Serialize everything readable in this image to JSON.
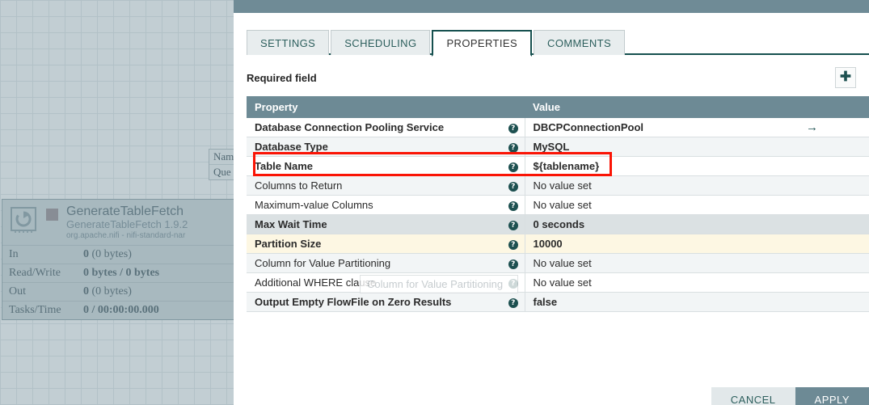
{
  "canvas": {
    "connection_label": {
      "name_row": "Nam",
      "queued_row": "Que"
    },
    "processor": {
      "icon": "processor-refresh-icon",
      "status_indicator": "stopped-square-icon",
      "name": "GenerateTableFetch",
      "type_version": "GenerateTableFetch 1.9.2",
      "bundle": "org.apache.nifi - nifi-standard-nar",
      "stats": [
        {
          "label": "In",
          "value": "0",
          "suffix": " (0 bytes)"
        },
        {
          "label": "Read/Write",
          "value": "0 bytes / 0 bytes",
          "suffix": ""
        },
        {
          "label": "Out",
          "value": "0",
          "suffix": " (0 bytes)"
        },
        {
          "label": "Tasks/Time",
          "value": "0 / 00:00:00.000",
          "suffix": ""
        }
      ]
    }
  },
  "dialog": {
    "tabs": [
      {
        "label": "SETTINGS",
        "active": false
      },
      {
        "label": "SCHEDULING",
        "active": false
      },
      {
        "label": "PROPERTIES",
        "active": true
      },
      {
        "label": "COMMENTS",
        "active": false
      }
    ],
    "required_field_label": "Required field",
    "add_property_icon": "plus-icon",
    "table": {
      "headers": {
        "property": "Property",
        "value": "Value",
        "extra": ""
      },
      "rows": [
        {
          "property": "Database Connection Pooling Service",
          "value": "DBCPConnectionPool",
          "required": true,
          "no_value": false,
          "extra": "→",
          "style": "row-odd"
        },
        {
          "property": "Database Type",
          "value": "MySQL",
          "required": true,
          "no_value": false,
          "extra": "",
          "style": "row-even"
        },
        {
          "property": "Table Name",
          "value": "${tablename}",
          "required": true,
          "no_value": false,
          "extra": "",
          "style": "row-odd"
        },
        {
          "property": "Columns to Return",
          "value": "No value set",
          "required": false,
          "no_value": true,
          "extra": "",
          "style": "row-even"
        },
        {
          "property": "Maximum-value Columns",
          "value": "No value set",
          "required": false,
          "no_value": true,
          "extra": "",
          "style": "row-odd"
        },
        {
          "property": "Max Wait Time",
          "value": "0 seconds",
          "required": true,
          "no_value": false,
          "extra": "",
          "style": "row-hl"
        },
        {
          "property": "Partition Size",
          "value": "10000",
          "required": true,
          "no_value": false,
          "extra": "",
          "style": "row-warn"
        },
        {
          "property": "Column for Value Partitioning",
          "value": "No value set",
          "required": false,
          "no_value": true,
          "extra": "",
          "style": "row-even"
        },
        {
          "property": "Additional WHERE clause",
          "value": "No value set",
          "required": false,
          "no_value": true,
          "extra": "",
          "style": "row-odd"
        },
        {
          "property": "Output Empty FlowFile on Zero Results",
          "value": "false",
          "required": true,
          "no_value": false,
          "extra": "",
          "style": "row-even"
        }
      ],
      "help_icon": "help-question-icon"
    },
    "drag_ghost_label": "Column for Value Partitioning",
    "footer": {
      "cancel_label": "CANCEL",
      "apply_label": "APPLY"
    }
  },
  "annotation": {
    "highlight_color": "#fa1405",
    "highlighted_property": "Table Name"
  }
}
